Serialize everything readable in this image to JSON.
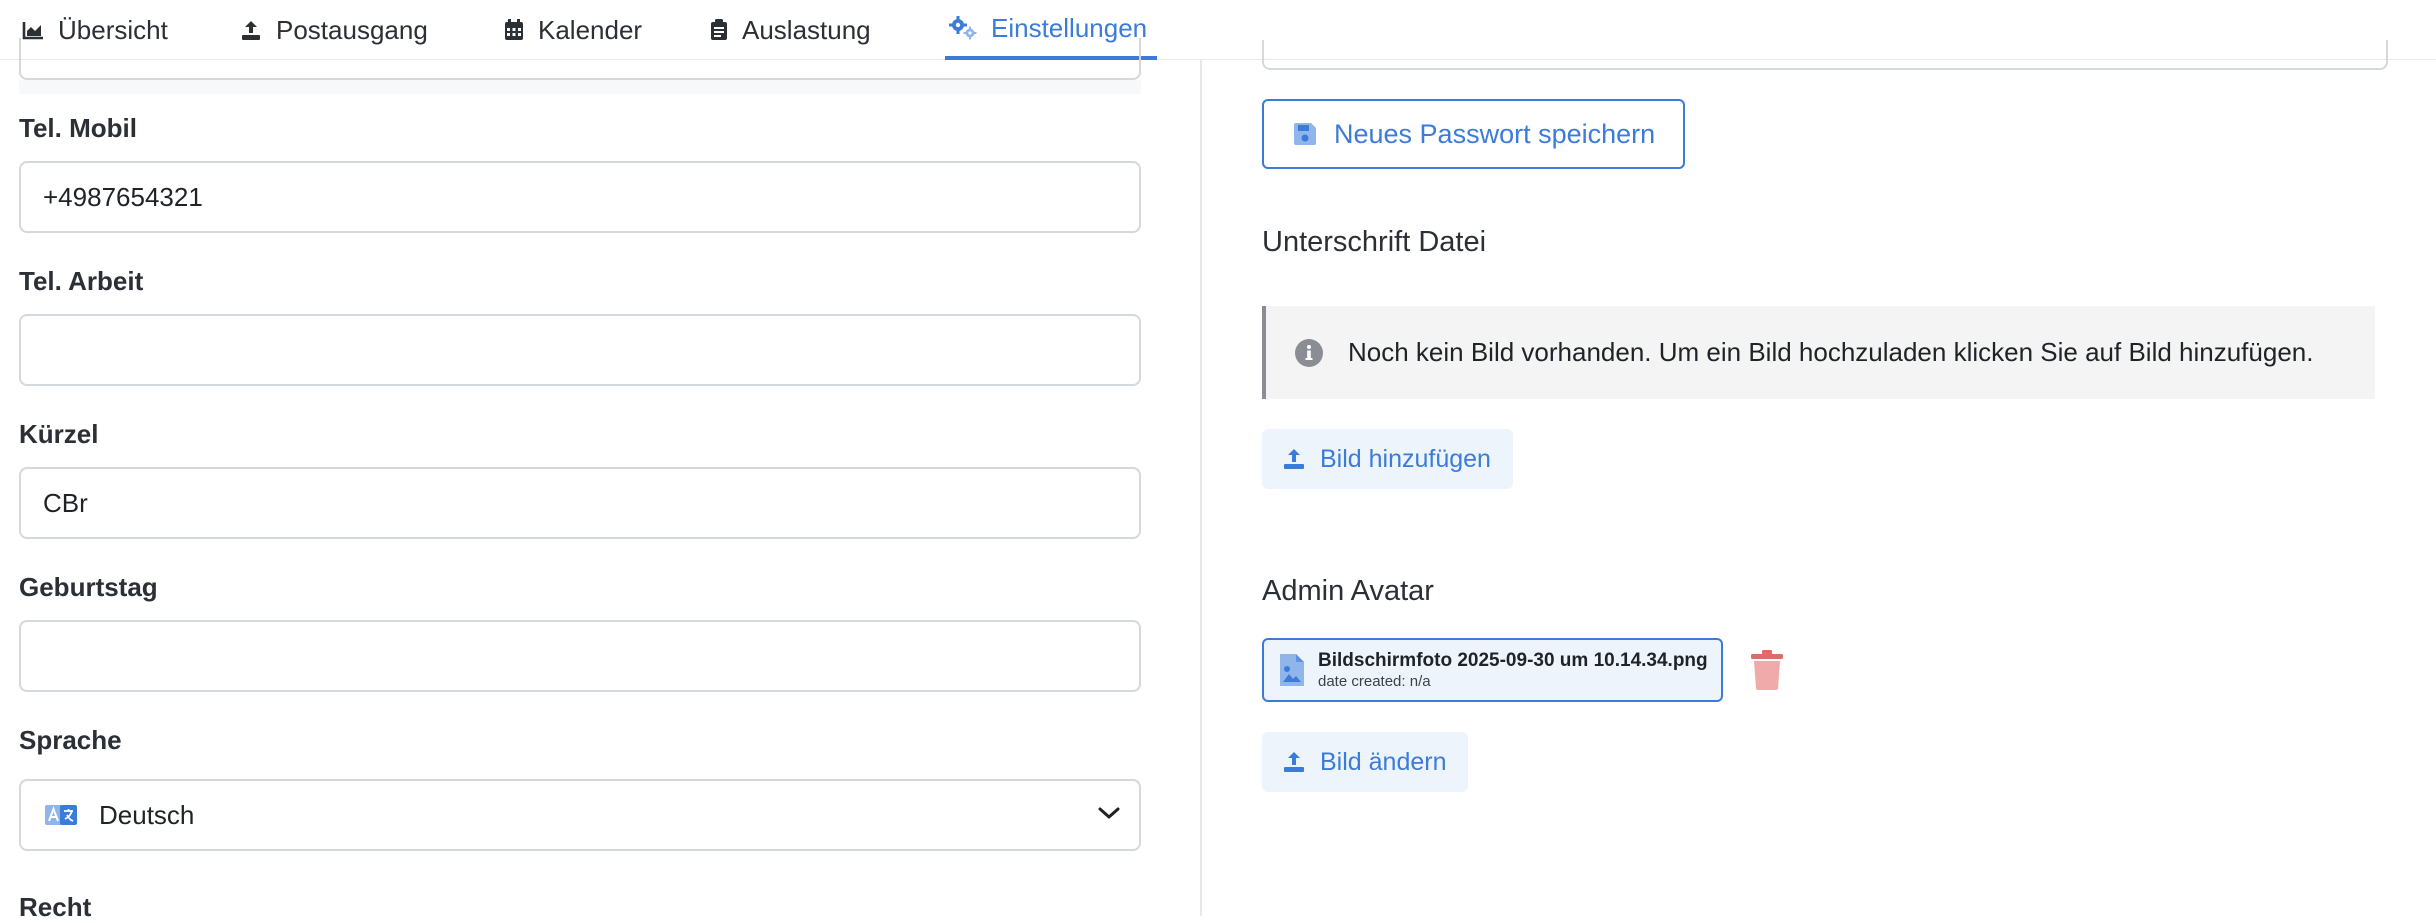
{
  "nav": {
    "tabs": [
      {
        "label": "Übersicht",
        "icon": "chart-area-icon"
      },
      {
        "label": "Postausgang",
        "icon": "upload-icon"
      },
      {
        "label": "Kalender",
        "icon": "calendar-icon"
      },
      {
        "label": "Auslastung",
        "icon": "clipboard-icon"
      },
      {
        "label": "Einstellungen",
        "icon": "gears-icon",
        "active": true
      }
    ]
  },
  "form": {
    "mobile": {
      "label": "Tel. Mobil",
      "value": "+4987654321"
    },
    "work": {
      "label": "Tel. Arbeit",
      "value": ""
    },
    "short": {
      "label": "Kürzel",
      "value": "CBr"
    },
    "birthday": {
      "label": "Geburtstag",
      "value": ""
    },
    "language": {
      "label": "Sprache",
      "value": "Deutsch",
      "icon": "language-icon"
    },
    "rights": {
      "label": "Recht"
    }
  },
  "password": {
    "save_label": "Neues Passwort speichern",
    "icon": "floppy-disk-icon"
  },
  "signature": {
    "title": "Unterschrift Datei",
    "info": "Noch kein Bild vorhanden. Um ein Bild hochzuladen klicken Sie auf Bild hinzufügen.",
    "add_label": "Bild hinzufügen"
  },
  "avatar": {
    "title": "Admin Avatar",
    "file_name": "Bildschirmfoto 2025-09-30 um 10.14.34.png",
    "file_meta": "date created: n/a",
    "change_label": "Bild ändern"
  },
  "colors": {
    "accent": "#3b7bd9",
    "danger": "#e06a6a",
    "soft_bg": "#eef4fc"
  }
}
